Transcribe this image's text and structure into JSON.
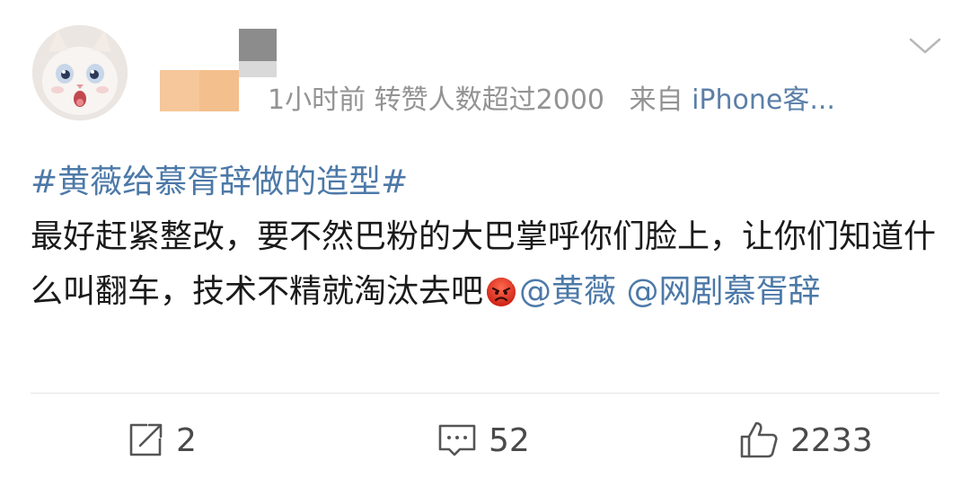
{
  "post": {
    "meta": {
      "time": "1小时前",
      "reposts_note": "转赞人数超过2000",
      "source_prefix": "来自",
      "source": "iPhone客..."
    },
    "content": {
      "topic": "#黄薇给慕胥辞做的造型#",
      "text": "最好赶紧整改，要不然巴粉的大巴掌呼你们脸上，让你们知道什么叫翻车，技术不精就淘汰去吧",
      "mention_1": "@黄薇",
      "mention_2": "@网剧慕胥辞"
    },
    "actions": {
      "repost_count": "2",
      "comment_count": "52",
      "like_count": "2233"
    }
  },
  "icons": {
    "avatar": "cat-avatar",
    "more": "chevron-down-icon",
    "emoji": "angry-face-emoji",
    "repost": "repost-icon",
    "comment": "comment-icon",
    "like": "thumbs-up-icon"
  },
  "colors": {
    "link": "#4c79a8",
    "meta_text": "#939393",
    "body_text": "#1a1a1a"
  }
}
